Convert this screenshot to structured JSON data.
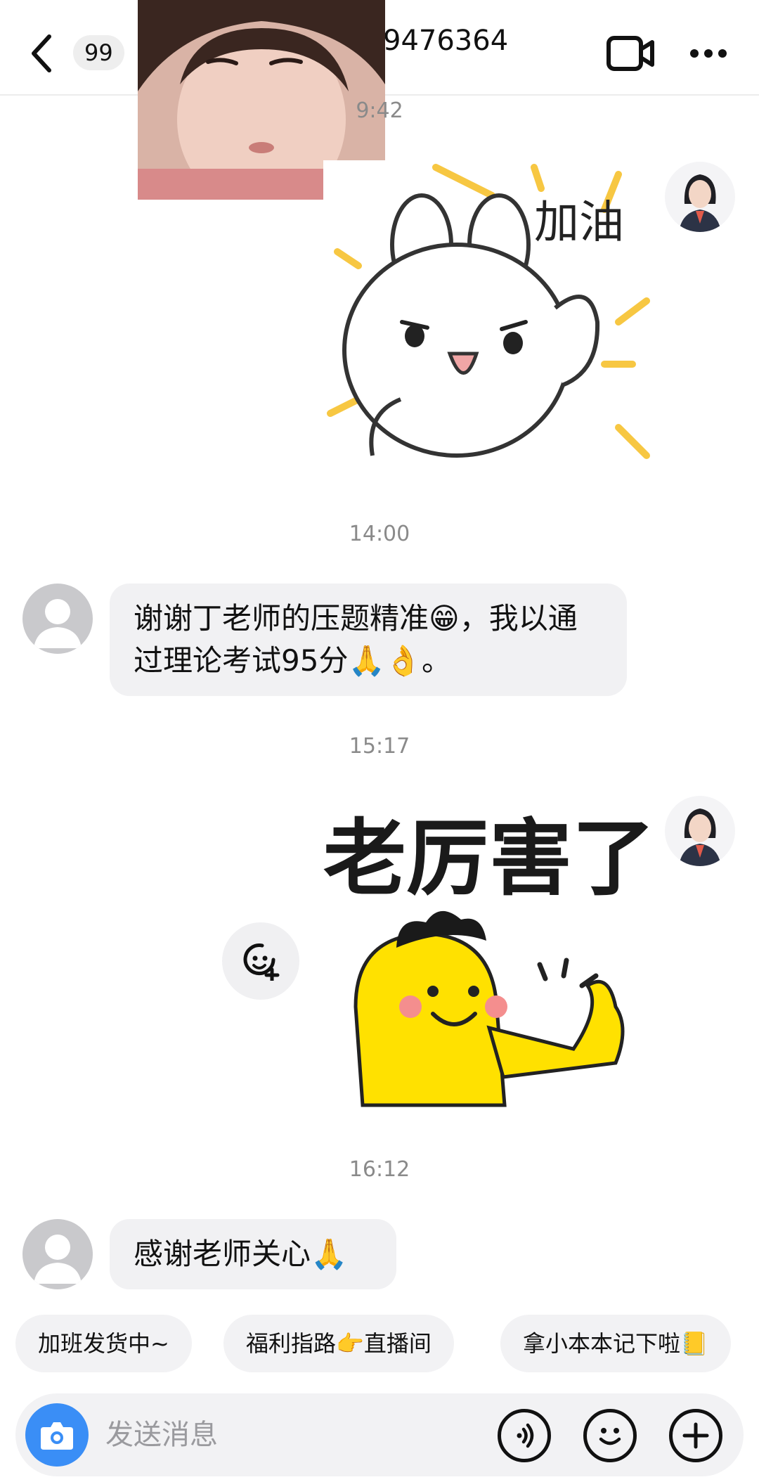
{
  "header": {
    "unread_count": "99",
    "title_partial": "9476364"
  },
  "messages": [
    {
      "time": "9:42"
    },
    {
      "time": "14:00",
      "text": "谢谢丁老师的压题精准😁，我以通过理论考试95分🙏👌。"
    },
    {
      "time": "15:17"
    },
    {
      "time": "16:12",
      "text": "感谢老师关心🙏"
    }
  ],
  "stickers": {
    "jiayou_text": "加油",
    "laolihai_text": "老厉害了"
  },
  "quick_replies": [
    "加班发货中~",
    "福利指路👉直播间",
    "拿小本本记下啦📒"
  ],
  "input": {
    "placeholder": "发送消息"
  },
  "colors": {
    "camera_button": "#3a8ef6",
    "bubble_bg": "#f1f1f3",
    "timestamp": "#8a8a8a"
  },
  "icons": [
    "back-chevron-icon",
    "video-call-icon",
    "more-icon",
    "add-emoji-icon",
    "camera-icon",
    "voice-icon",
    "emoji-icon",
    "plus-icon"
  ]
}
